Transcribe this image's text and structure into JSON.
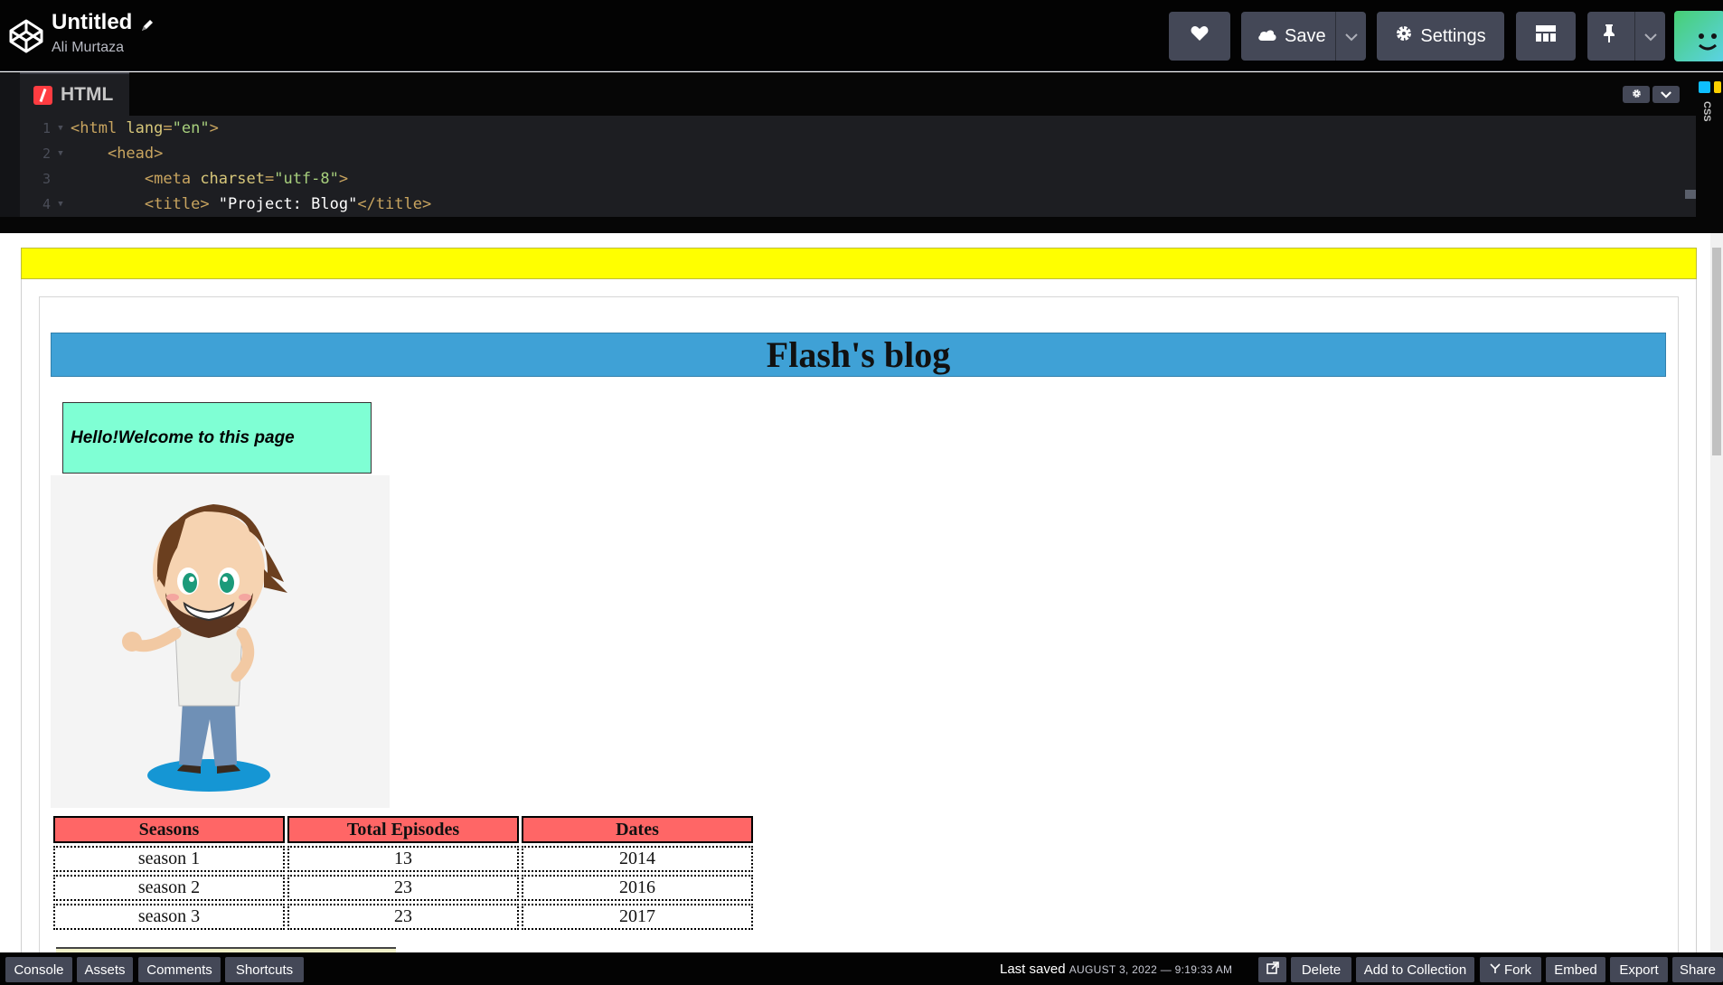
{
  "header": {
    "pen_title": "Untitled",
    "author": "Ali Murtaza",
    "buttons": {
      "save_label": "Save",
      "settings_label": "Settings"
    }
  },
  "editor": {
    "tab_label": "HTML",
    "side_tab_label": "CSS",
    "lines": [
      {
        "number": "1",
        "indent": "",
        "tag_open": "<html",
        "attr": " lang",
        "eq": "=",
        "value": "\"en\"",
        "tag_close": ">",
        "text": "",
        "end_tag": ""
      },
      {
        "number": "2",
        "indent": "    ",
        "tag_open": "<head",
        "attr": "",
        "eq": "",
        "value": "",
        "tag_close": ">",
        "text": "",
        "end_tag": ""
      },
      {
        "number": "3",
        "indent": "        ",
        "tag_open": "<meta",
        "attr": " charset",
        "eq": "=",
        "value": "\"utf-8\"",
        "tag_close": ">",
        "text": "",
        "end_tag": ""
      },
      {
        "number": "4",
        "indent": "        ",
        "tag_open": "<title",
        "attr": "",
        "eq": "",
        "value": "",
        "tag_close": ">",
        "text": " \"Project: Blog\"",
        "end_tag": "</title>"
      }
    ]
  },
  "preview": {
    "blog_title": "Flash's blog",
    "welcome_text": "Hello!Welcome to this page",
    "table": {
      "headers": [
        "Seasons",
        "Total Episodes",
        "Dates"
      ],
      "rows": [
        [
          "season 1",
          "13",
          "2014"
        ],
        [
          "season 2",
          "23",
          "2016"
        ],
        [
          "season 3",
          "23",
          "2017"
        ]
      ]
    }
  },
  "footer": {
    "left_buttons": [
      "Console",
      "Assets",
      "Comments",
      "Shortcuts"
    ],
    "last_saved_label": "Last saved",
    "last_saved_time": "AUGUST 3, 2022 — 9:19:33 AM",
    "right_buttons": {
      "delete": "Delete",
      "add_to_collection": "Add to Collection",
      "fork": "Fork",
      "embed": "Embed",
      "export": "Export",
      "share": "Share"
    }
  },
  "colors": {
    "topbar": "#030303",
    "button": "#444857",
    "editor_bg": "#1d1e22",
    "html_badge": "#ff3c41",
    "css_badge": "#0ebeff",
    "preview_banner": "#ffff00",
    "blog_header": "#3fa1d6",
    "welcome_box": "#7fffd4",
    "table_header": "#ff6666"
  }
}
